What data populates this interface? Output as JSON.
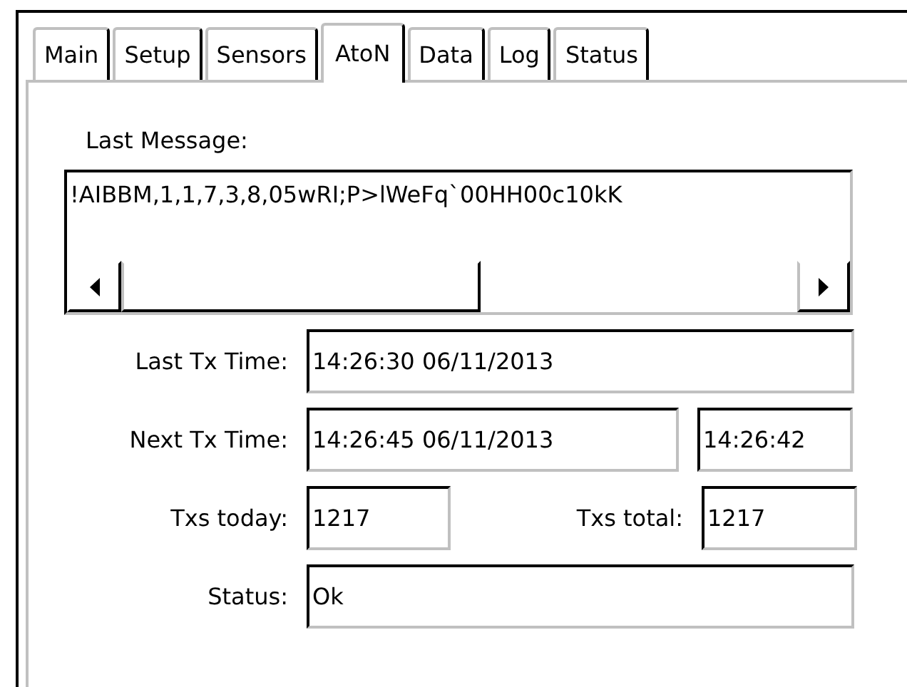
{
  "tabs": [
    {
      "label": "Main",
      "selected": false
    },
    {
      "label": "Setup",
      "selected": false
    },
    {
      "label": "Sensors",
      "selected": false
    },
    {
      "label": "AtoN",
      "selected": true
    },
    {
      "label": "Data",
      "selected": false
    },
    {
      "label": "Log",
      "selected": false
    },
    {
      "label": "Status",
      "selected": false
    }
  ],
  "last_message": {
    "label": "Last Message:",
    "value": "!AIBBM,1,1,7,3,8,05wRI;P>lWeFq`00HH00c10kK"
  },
  "last_tx_time": {
    "label": "Last Tx Time:",
    "value": "14:26:30 06/11/2013"
  },
  "next_tx_time": {
    "label": "Next Tx Time:",
    "value": "14:26:45 06/11/2013",
    "countdown": "14:26:42"
  },
  "txs_today": {
    "label": "Txs today:",
    "value": "1217"
  },
  "txs_total": {
    "label": "Txs total:",
    "value": "1217"
  },
  "status": {
    "label": "Status:",
    "value": "Ok"
  }
}
